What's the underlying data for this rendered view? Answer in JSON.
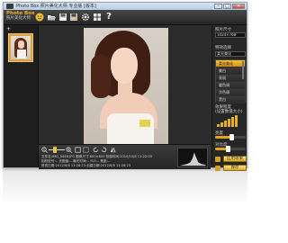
{
  "window": {
    "title": "Photo Box 照片美化大师 专业版 [版本]",
    "min": "–",
    "max": "□",
    "close": "✕"
  },
  "logo": {
    "line1": "Photo Box",
    "line2": "照片美化大师"
  },
  "toolbar": {
    "icons": [
      "smiley-icon",
      "open-folder-icon",
      "save-icon",
      "save-as-icon",
      "settings-icon",
      "grid-icon",
      "help-icon"
    ],
    "help_glyph": "?"
  },
  "thumbnails": {
    "add_label": "+"
  },
  "right_panel": {
    "size_label": "照片尺寸",
    "size_value": "1024×768",
    "effect_label": "特效选择",
    "effects": [
      "柔光美化",
      "美白",
      "亮丽",
      "暖色调",
      "冷色调",
      "黑白"
    ],
    "effect_active_index": 0,
    "strength_label": "效果程度",
    "strength_sub": "(设置数值大小)",
    "brightness_label": "亮度",
    "contrast_label": "对比度",
    "apply_button": "应用效果",
    "save_button": "保存",
    "accent_color": "#e7b021"
  },
  "bottom": {
    "zoom_percent": 40,
    "info_lines": [
      "文件名:IMG_0448.JPG  图像尺寸:800×600  拍摄时间:2010/10/8 11:22:03",
      "相机型号:--  光圈值:--  曝光时间:--  ISO:--  焦距:--",
      "修改日期:2012/6/8 13:28:23  创建日期:2012/6/8 13:28:23"
    ]
  }
}
